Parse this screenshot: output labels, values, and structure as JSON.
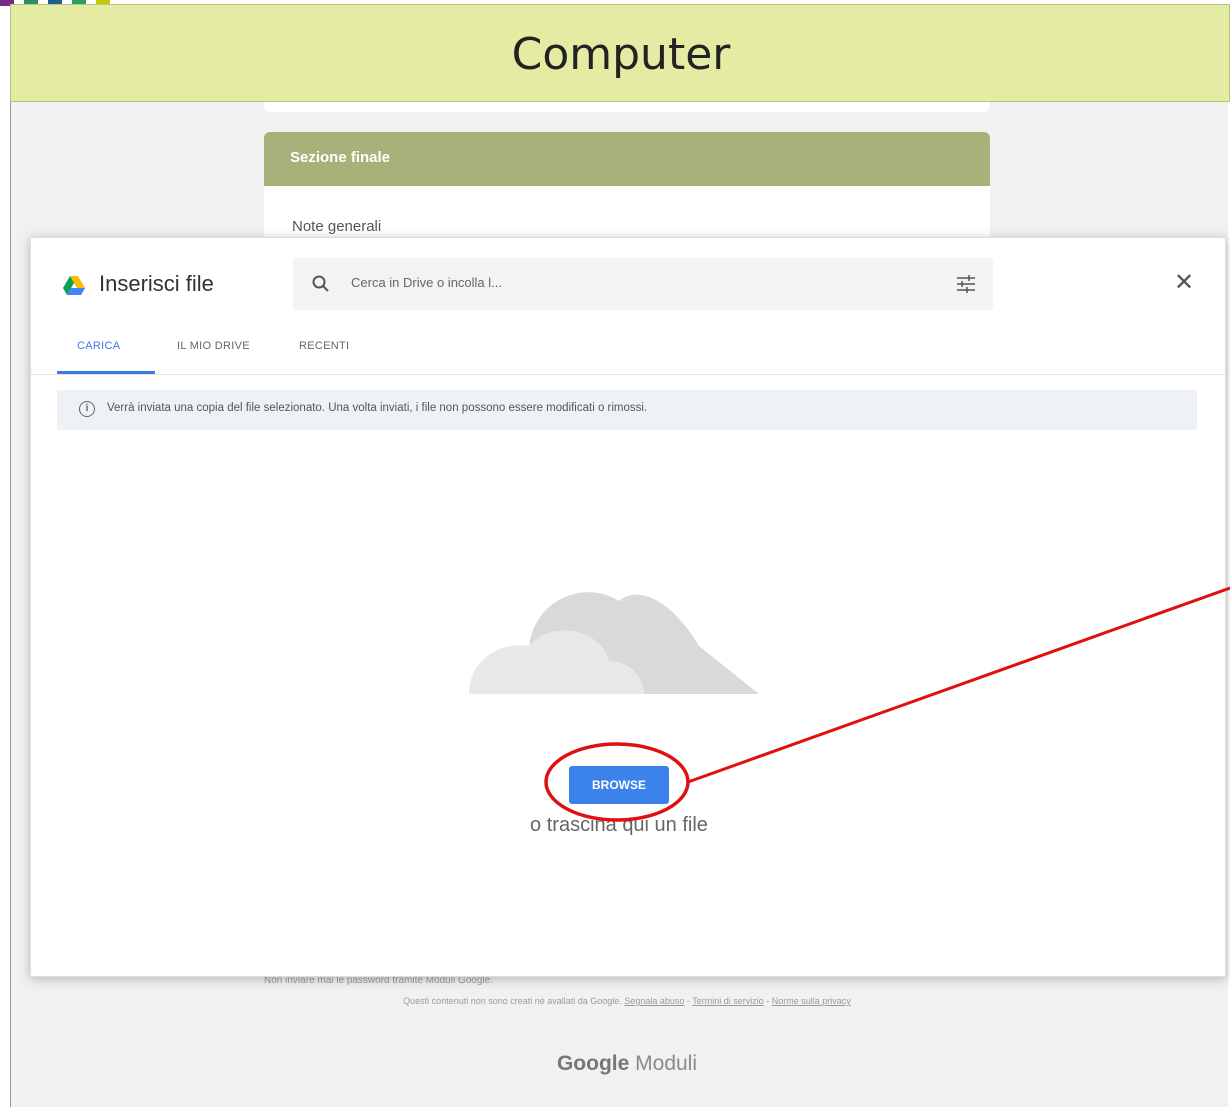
{
  "slide": {
    "title": "Computer",
    "stripe_colors": [
      "#7b2a8c",
      "#2b8f5f",
      "#1f5f8f",
      "#2b9f5f",
      "#c8c800"
    ],
    "banner_color": "#e4eca3",
    "annotation_color": "#e01010"
  },
  "form": {
    "section_title": "Sezione finale",
    "note_label": "Note generali",
    "footer_warning": "Non inviare mai le password tramite Moduli Google.",
    "footer_legal": {
      "text": "Questi contenuti non sono creati né avallati da Google.",
      "links": [
        "Segnala abuso",
        "Termini di servizio",
        "Norme sulla privacy"
      ]
    },
    "brand_google": "Google",
    "brand_moduli": "Moduli",
    "header_color": "#a9b17b"
  },
  "modal": {
    "title": "Inserisci file",
    "drive_icon": "google-drive-icon",
    "search_placeholder": "Cerca in Drive o incolla l...",
    "tabs": [
      {
        "label": "CARICA",
        "active": true
      },
      {
        "label": "IL MIO DRIVE",
        "active": false
      },
      {
        "label": "RECENTI",
        "active": false
      }
    ],
    "info_text": "Verrà inviata una copia del file selezionato. Una volta inviati, i file non possono essere modificati o rimossi.",
    "browse_label": "BROWSE",
    "drop_text": "o trascina qui un file",
    "accent_color": "#3b78e7"
  }
}
